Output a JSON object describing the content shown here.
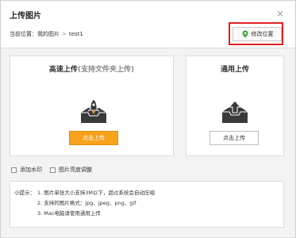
{
  "dialog": {
    "title": "上传图片"
  },
  "location": {
    "label": "当前位置：",
    "path_root": "我的图片",
    "separator": ">",
    "path_current": "test1",
    "change_button": "修改位置"
  },
  "fast_upload": {
    "title": "高速上传",
    "subtitle": "(支持文件夹上传)",
    "button": "点击上传",
    "icon": "rocket-upload-icon"
  },
  "normal_upload": {
    "title": "通用上传",
    "button": "点击上传",
    "icon": "arrow-upload-icon"
  },
  "options": {
    "watermark": "添加水印",
    "brightness": "图片亮度调整"
  },
  "tips": {
    "prefix": "小提示：",
    "lines": [
      "1. 图片单张大小支持3M以下，超过系统会自动压缩",
      "2. 支持的图片格式：jpg、jpeg、png、gif",
      "3. Mac电脑请使用通用上传"
    ]
  },
  "colors": {
    "accent_orange": "#f9a21b",
    "highlight_red": "#e02020",
    "pin_green": "#3aa33a"
  }
}
